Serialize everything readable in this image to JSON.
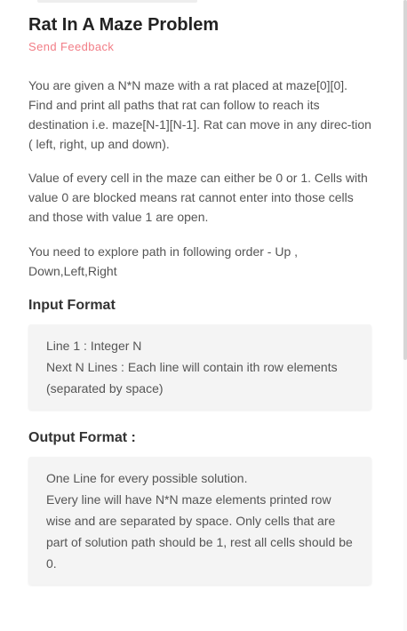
{
  "problem": {
    "title": "Rat In A Maze Problem",
    "feedback_label": "Send Feedback"
  },
  "description": {
    "paragraphs": [
      "You are given a N*N maze with a rat placed at maze[0][0]. Find and print all paths that rat can follow to reach its destination i.e. maze[N-1][N-1]. Rat can move in any direc-tion ( left, right, up and down).",
      "Value of every cell in the maze can either be 0 or 1. Cells with value 0 are blocked means rat cannot enter into those cells and those with value 1 are open.",
      "You need to explore path in following order - Up , Down,Left,Right"
    ]
  },
  "input_format": {
    "heading": "Input Format",
    "lines": [
      "Line 1 : Integer N",
      "Next N Lines : Each line will contain ith row elements (separated by space)"
    ]
  },
  "output_format": {
    "heading": "Output Format :",
    "lines": [
      "One Line for every possible solution.",
      "Every line will have N*N maze elements printed row wise and are separated by space. Only cells that are part of solution path should be 1, rest all cells should be 0."
    ]
  },
  "colors": {
    "accent": "#f27d86",
    "heading": "#222222",
    "body_text": "#555555",
    "box_bg": "#f4f4f4"
  }
}
